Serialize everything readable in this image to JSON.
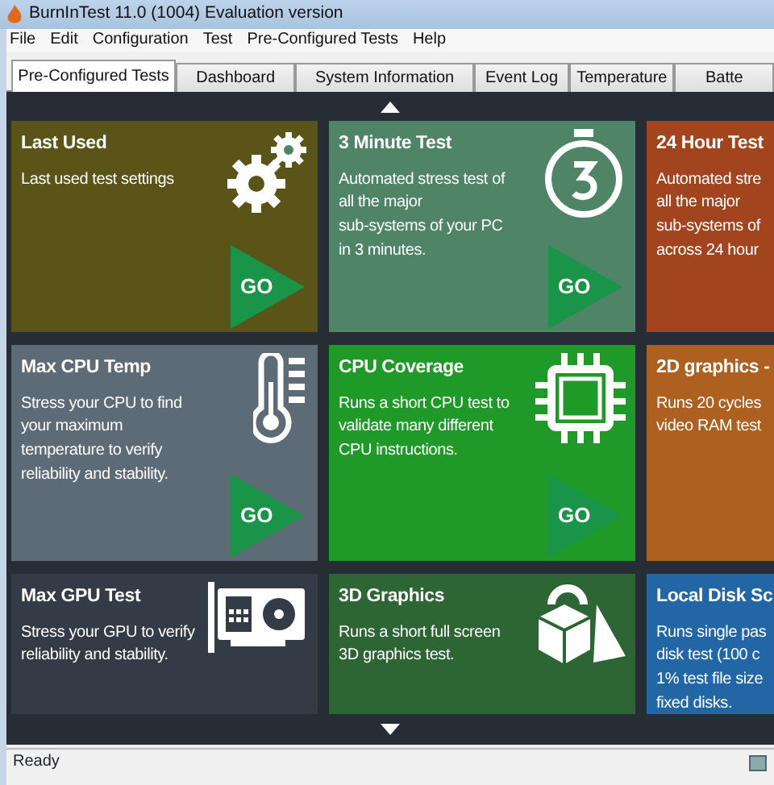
{
  "window": {
    "title": "BurnInTest 11.0 (1004) Evaluation version"
  },
  "menu": [
    "File",
    "Edit",
    "Configuration",
    "Test",
    "Pre-Configured Tests",
    "Help"
  ],
  "tabs": [
    {
      "label": "Pre-Configured Tests",
      "selected": true
    },
    {
      "label": "Dashboard",
      "selected": false
    },
    {
      "label": "System Information",
      "selected": false
    },
    {
      "label": "Event Log",
      "selected": false
    },
    {
      "label": "Temperature",
      "selected": false
    },
    {
      "label": "Batte",
      "selected": false
    }
  ],
  "tiles": [
    {
      "title": "Last Used",
      "lines": [
        "Last used test settings"
      ],
      "kind": "gears",
      "color": "#5a5418",
      "go": "GO"
    },
    {
      "title": "3 Minute Test",
      "lines": [
        "Automated stress test of",
        "all the major",
        "sub-systems of your PC",
        "in 3 minutes."
      ],
      "kind": "stopwatch",
      "color": "#4f8566",
      "go": "GO"
    },
    {
      "title": "24 Hour Test",
      "lines": [
        "Automated stre",
        "all the major",
        "sub-systems of",
        "across 24 hour"
      ],
      "kind": "plain",
      "color": "#a2441e"
    },
    {
      "title": "Max CPU Temp",
      "lines": [
        "Stress your CPU to find",
        "your maximum",
        "temperature to verify",
        "reliability and stability."
      ],
      "kind": "thermometer",
      "color": "#5d6b76",
      "go": "GO"
    },
    {
      "title": "CPU Coverage",
      "lines": [
        "Runs a short CPU test to",
        "validate many different",
        "CPU instructions."
      ],
      "kind": "chip",
      "color": "#1f9a28",
      "go": "GO"
    },
    {
      "title": "2D graphics -",
      "lines": [
        "Runs 20 cycles",
        "video RAM test"
      ],
      "kind": "plain",
      "color": "#ad6020"
    },
    {
      "title": "Max GPU Test",
      "lines": [
        "Stress your GPU to verify",
        "reliability and stability."
      ],
      "kind": "gpu",
      "color": "#333c46"
    },
    {
      "title": "3D Graphics",
      "lines": [
        "Runs a short full screen",
        "3D graphics test."
      ],
      "kind": "shapes",
      "color": "#2e6534"
    },
    {
      "title": "Local Disk Sc",
      "lines": [
        "Runs single pas",
        "disk test (100 c",
        "1% test file size",
        "fixed disks."
      ],
      "kind": "plain",
      "color": "#2266a6"
    }
  ],
  "status_bar": {
    "text": "Ready"
  }
}
